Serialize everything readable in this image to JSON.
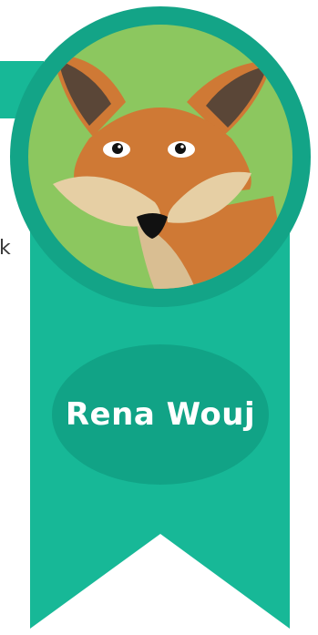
{
  "medal": {
    "name": "Rena Wouj",
    "edge_char": "k"
  },
  "colors": {
    "ribbon": "#17b897",
    "ring": "#13a487",
    "badge": "#11a386",
    "background_green": "#8cc75f",
    "fox_orange": "#cf7935",
    "fox_cream": "#e6cfa4",
    "ear_dark": "#5a4637"
  },
  "icons": {
    "avatar": "fox-icon"
  }
}
